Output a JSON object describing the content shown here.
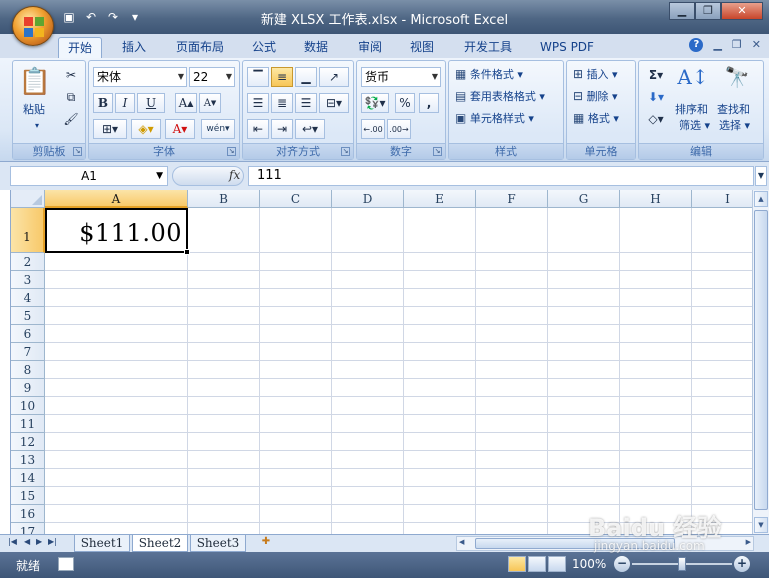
{
  "window": {
    "title": "新建 XLSX 工作表.xlsx - Microsoft Excel",
    "minimize_icon": "minimize-icon",
    "restore_icon": "restore-icon",
    "close_icon": "close-icon"
  },
  "tabs": [
    {
      "label": "开始",
      "active": true
    },
    {
      "label": "插入"
    },
    {
      "label": "页面布局"
    },
    {
      "label": "公式"
    },
    {
      "label": "数据"
    },
    {
      "label": "审阅"
    },
    {
      "label": "视图"
    },
    {
      "label": "开发工具"
    },
    {
      "label": "WPS PDF"
    }
  ],
  "ribbon": {
    "clipboard": {
      "label": "剪贴板",
      "paste": "粘贴"
    },
    "font": {
      "label": "字体",
      "name": "宋体",
      "size": "22",
      "bold": "B",
      "italic": "I",
      "underline": "U",
      "phonetic": "wén"
    },
    "alignment": {
      "label": "对齐方式"
    },
    "number": {
      "label": "数字",
      "format": "货币",
      "percent": "%",
      "comma": ",",
      "inc_decimal": ".00",
      "dec_decimal": ".00"
    },
    "styles": {
      "label": "样式",
      "conditional": "条件格式",
      "table": "套用表格格式",
      "cell_styles": "单元格样式"
    },
    "cells": {
      "label": "单元格",
      "insert": "插入",
      "delete": "删除",
      "format": "格式"
    },
    "editing": {
      "label": "编辑",
      "sort": "排序和",
      "sort2": "筛选",
      "find": "查找和",
      "find2": "选择",
      "sigma": "Σ"
    }
  },
  "formula_bar": {
    "name_box": "A1",
    "fx": "fx",
    "value": "111"
  },
  "grid": {
    "columns": [
      "A",
      "B",
      "C",
      "D",
      "E",
      "F",
      "G",
      "H",
      "I"
    ],
    "rows": [
      "1",
      "2",
      "3",
      "4",
      "5",
      "6",
      "7",
      "8",
      "9",
      "10",
      "11",
      "12",
      "13",
      "14",
      "15",
      "16",
      "17"
    ],
    "active_cell": "A1",
    "a1_display": "$111.00"
  },
  "sheets": [
    {
      "label": "Sheet1"
    },
    {
      "label": "Sheet2",
      "active": true
    },
    {
      "label": "Sheet3"
    }
  ],
  "status": {
    "mode": "就绪",
    "zoom": "100%",
    "zoom_minus": "−",
    "zoom_plus": "+"
  },
  "watermark": {
    "brand": "Baidu 经验",
    "url": "jingyan.baidu.com"
  }
}
